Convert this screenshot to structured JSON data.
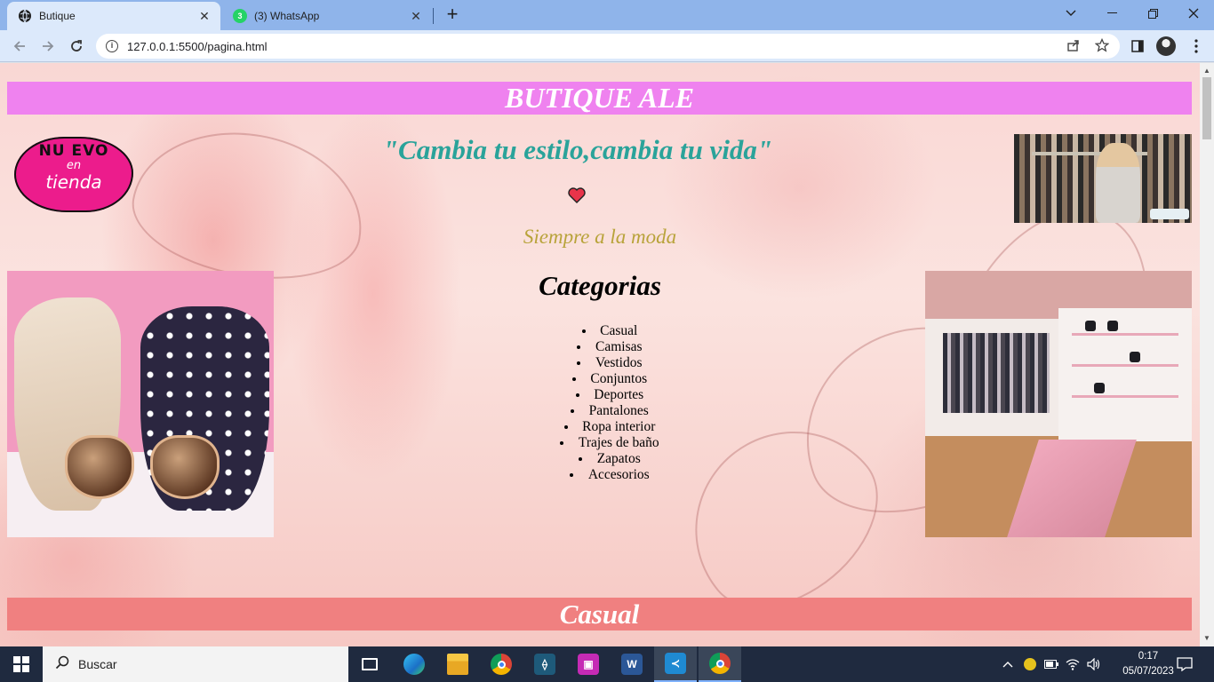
{
  "browser": {
    "tabs": [
      {
        "title": "Butique",
        "active": true,
        "icon": "globe-icon"
      },
      {
        "title": "(3) WhatsApp",
        "active": false,
        "icon": "whatsapp-icon",
        "badge": "3"
      }
    ],
    "url": "127.0.0.1:5500/pagina.html",
    "new_tab_symbol": "+",
    "close_symbol": "✕"
  },
  "page": {
    "banner_title": "BUTIQUE ALE",
    "slogan": "\"Cambia tu estilo,cambia tu vida\"",
    "tagline": "Siempre a la moda",
    "categories_title": "Categorias",
    "categories": [
      "Casual",
      "Camisas",
      "Vestidos",
      "Conjuntos",
      "Deportes",
      "Pantalones",
      "Ropa interior",
      "Trajes de baño",
      "Zapatos",
      "Accesorios"
    ],
    "section_title": "Casual",
    "nuevo_badge": {
      "line1": "NU EVO",
      "line2": "en",
      "line3": "tienda"
    },
    "colors": {
      "banner": "#ef82ef",
      "section_banner": "#f08080",
      "slogan": "#2aa39a",
      "tagline": "#b8a33a"
    }
  },
  "taskbar": {
    "search_placeholder": "Buscar",
    "time": "0:17",
    "date": "05/07/2023",
    "apps": [
      "task-view-icon",
      "edge-icon",
      "file-explorer-icon",
      "chrome-icon",
      "mysql-workbench-icon",
      "app-icon",
      "word-icon",
      "vscode-icon",
      "chrome-active-icon"
    ]
  }
}
